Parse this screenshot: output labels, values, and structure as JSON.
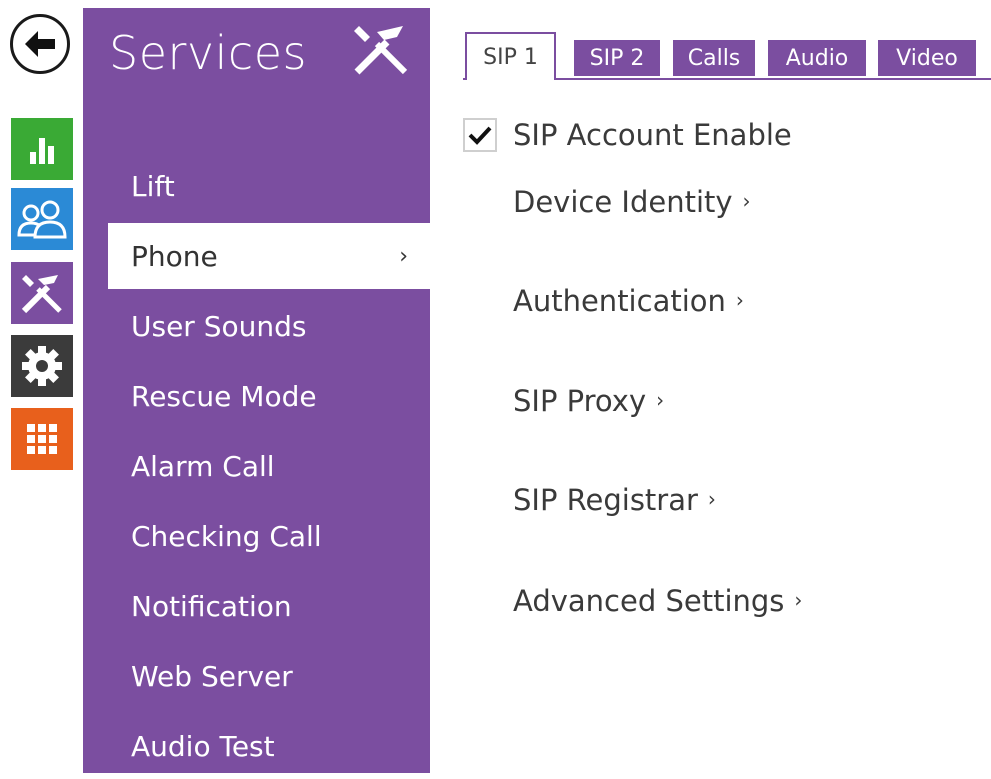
{
  "rail": {
    "back": {
      "icon": "back-arrow-icon"
    },
    "items": [
      {
        "name": "status",
        "icon": "bar-chart-icon",
        "color": "#3aaa35"
      },
      {
        "name": "directory",
        "icon": "users-icon",
        "color": "#2b8ad6"
      },
      {
        "name": "services",
        "icon": "tools-icon",
        "color": "#7b4ea0"
      },
      {
        "name": "hardware",
        "icon": "gear-icon",
        "color": "#3b3b3b"
      },
      {
        "name": "system",
        "icon": "grid-icon",
        "color": "#e8601c"
      }
    ]
  },
  "menu": {
    "title": "Services",
    "title_icon": "tools-icon",
    "items": [
      {
        "label": "Lift",
        "active": false
      },
      {
        "label": "Phone",
        "active": true,
        "chevron": "›"
      },
      {
        "label": "User Sounds",
        "active": false
      },
      {
        "label": "Rescue Mode",
        "active": false
      },
      {
        "label": "Alarm Call",
        "active": false
      },
      {
        "label": "Checking Call",
        "active": false
      },
      {
        "label": "Notification",
        "active": false
      },
      {
        "label": "Web Server",
        "active": false
      },
      {
        "label": "Audio Test",
        "active": false
      }
    ]
  },
  "tabs": [
    {
      "label": "SIP 1",
      "active": true
    },
    {
      "label": "SIP 2",
      "active": false
    },
    {
      "label": "Calls",
      "active": false
    },
    {
      "label": "Audio",
      "active": false
    },
    {
      "label": "Video",
      "active": false
    }
  ],
  "content": {
    "sip_account_enable": {
      "label": "SIP Account Enable",
      "checked": true
    },
    "sections": [
      {
        "label": "Device Identity",
        "arrow": "›"
      },
      {
        "label": "Authentication",
        "arrow": "›"
      },
      {
        "label": "SIP Proxy",
        "arrow": "›"
      },
      {
        "label": "SIP Registrar",
        "arrow": "›"
      },
      {
        "label": "Advanced Settings",
        "arrow": "›"
      }
    ]
  },
  "colors": {
    "accent": "#7b4ea0",
    "status": "#3aaa35",
    "directory": "#2b8ad6",
    "hardware": "#3b3b3b",
    "system": "#e8601c"
  }
}
